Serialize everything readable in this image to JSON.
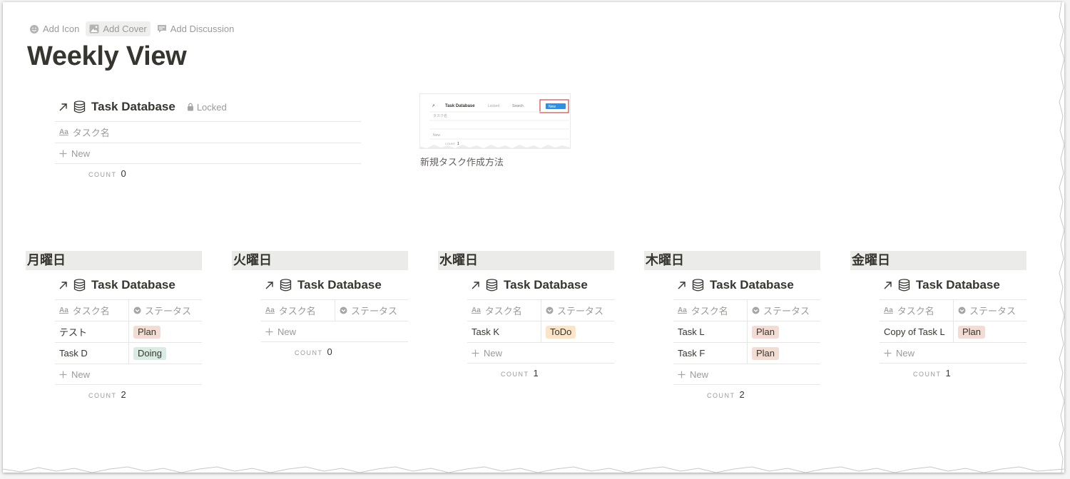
{
  "page_actions": {
    "add_icon": "Add Icon",
    "add_cover": "Add Cover",
    "add_discussion": "Add Discussion"
  },
  "title": "Weekly View",
  "main_db": {
    "title": "Task Database",
    "locked": "Locked",
    "name_col": "タスク名",
    "new": "New",
    "count_label": "COUNT",
    "count": "0"
  },
  "thumbnail": {
    "caption": "新規タスク作成方法",
    "db_title": "Task Database",
    "locked": "Locked",
    "search": "Search",
    "new_btn": "New",
    "name_col": "タスク名",
    "new": "New",
    "count_label": "COUNT",
    "count": "1"
  },
  "days": [
    {
      "label": "月曜日",
      "db_title": "Task Database",
      "col_name": "タスク名",
      "col_status": "ステータス",
      "rows": [
        {
          "name": "テスト",
          "status": "Plan"
        },
        {
          "name": "Task D",
          "status": "Doing"
        }
      ],
      "new": "New",
      "count_label": "COUNT",
      "count": "2"
    },
    {
      "label": "火曜日",
      "db_title": "Task Database",
      "col_name": "タスク名",
      "col_status": "ステータス",
      "rows": [],
      "new": "New",
      "count_label": "COUNT",
      "count": "0"
    },
    {
      "label": "水曜日",
      "db_title": "Task Database",
      "col_name": "タスク名",
      "col_status": "ステータス",
      "rows": [
        {
          "name": "Task K",
          "status": "ToDo"
        }
      ],
      "new": "New",
      "count_label": "COUNT",
      "count": "1"
    },
    {
      "label": "木曜日",
      "db_title": "Task Database",
      "col_name": "タスク名",
      "col_status": "ステータス",
      "rows": [
        {
          "name": "Task L",
          "status": "Plan"
        },
        {
          "name": "Task F",
          "status": "Plan"
        }
      ],
      "new": "New",
      "count_label": "COUNT",
      "count": "2"
    },
    {
      "label": "金曜日",
      "db_title": "Task Database",
      "col_name": "タスク名",
      "col_status": "ステータス",
      "rows": [
        {
          "name": "Copy of Task L",
          "status": "Plan"
        }
      ],
      "new": "New",
      "count_label": "COUNT",
      "count": "1"
    }
  ],
  "colors": {
    "plan": "#f2dcd3",
    "doing": "#d9ebe3",
    "todo": "#fbe4c8",
    "text": "#37352f",
    "muted": "#9b9a97",
    "header_bg": "#ebebea"
  },
  "icons": [
    "smile-icon",
    "image-icon",
    "comment-icon",
    "arrow-up-right-icon",
    "database-icon",
    "lock-icon",
    "plus-icon",
    "status-icon",
    "text-property-icon"
  ]
}
